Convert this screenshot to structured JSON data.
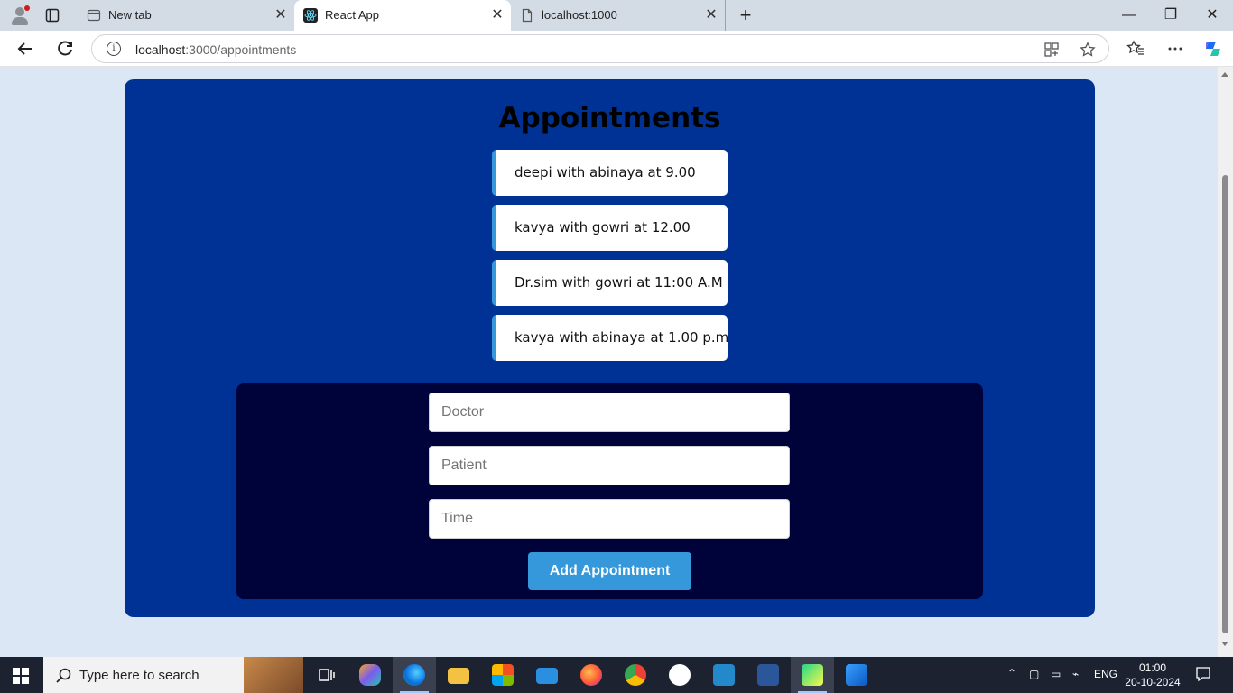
{
  "browser": {
    "tabs": [
      {
        "title": "New tab"
      },
      {
        "title": "React App"
      },
      {
        "title": "localhost:1000"
      }
    ],
    "url_host": "localhost",
    "url_path": ":3000/appointments"
  },
  "page": {
    "title": "Appointments",
    "appointments": [
      {
        "text": "deepi with abinaya at 9.00"
      },
      {
        "text": "kavya with gowri at 12.00"
      },
      {
        "text": "Dr.sim with gowri at 11:00 A.M"
      },
      {
        "text": "kavya with abinaya at 1.00 p.m"
      }
    ],
    "form": {
      "doctor_placeholder": "Doctor",
      "patient_placeholder": "Patient",
      "time_placeholder": "Time",
      "submit_label": "Add Appointment"
    }
  },
  "taskbar": {
    "search_placeholder": "Type here to search",
    "language": "ENG",
    "time": "01:00",
    "date": "20-10-2024"
  },
  "colors": {
    "card": "#003296",
    "form_panel": "#00023a",
    "accent": "#3498db",
    "page_bg": "#dbe7f4"
  }
}
